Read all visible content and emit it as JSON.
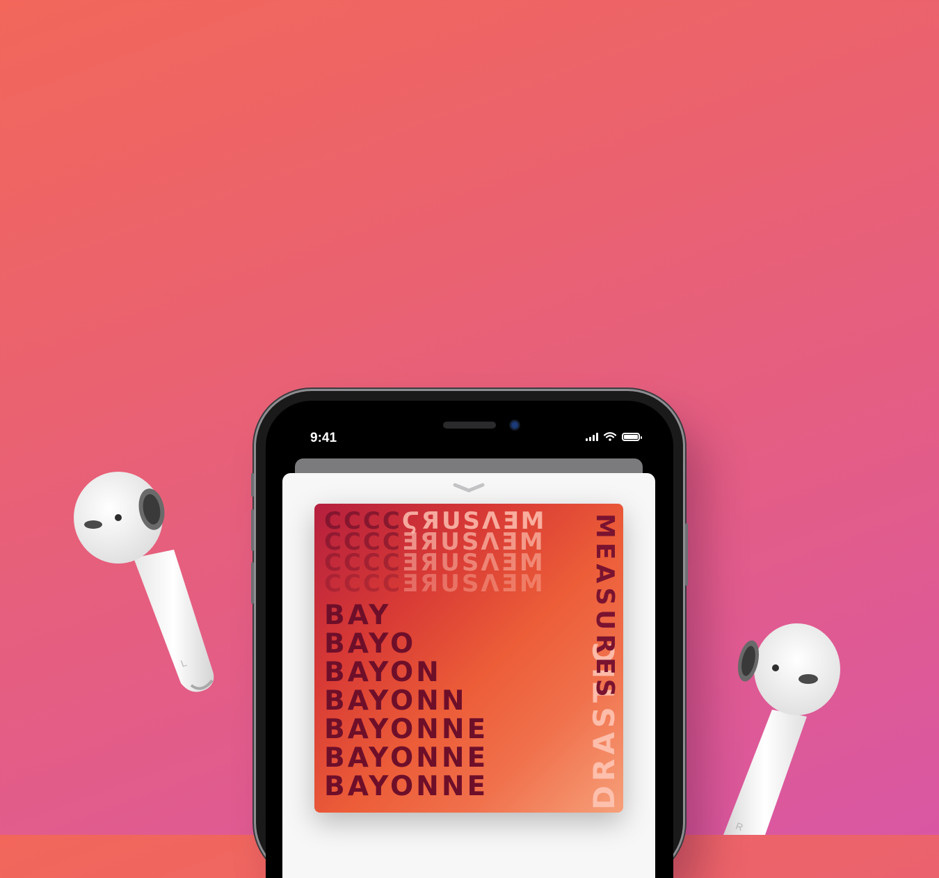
{
  "status_bar": {
    "time": "9:41"
  },
  "icons": {
    "signal": "cellular-signal-icon",
    "wifi": "wifi-icon",
    "battery": "battery-icon",
    "grabber": "chevron-down-icon"
  },
  "album_art": {
    "rows": [
      "BAY",
      "BAYO",
      "BAYON",
      "BAYONN",
      "BAYONNE",
      "BAYONNE",
      "BAYONNE"
    ],
    "top_word": "MEASURES",
    "side_word": "DRASTIC"
  },
  "airpods": {
    "left_label": "L",
    "right_label": "R"
  },
  "colors": {
    "bg_top": "#f2675a",
    "bg_bottom": "#d957a3",
    "art_text": "#6e0f2a"
  }
}
